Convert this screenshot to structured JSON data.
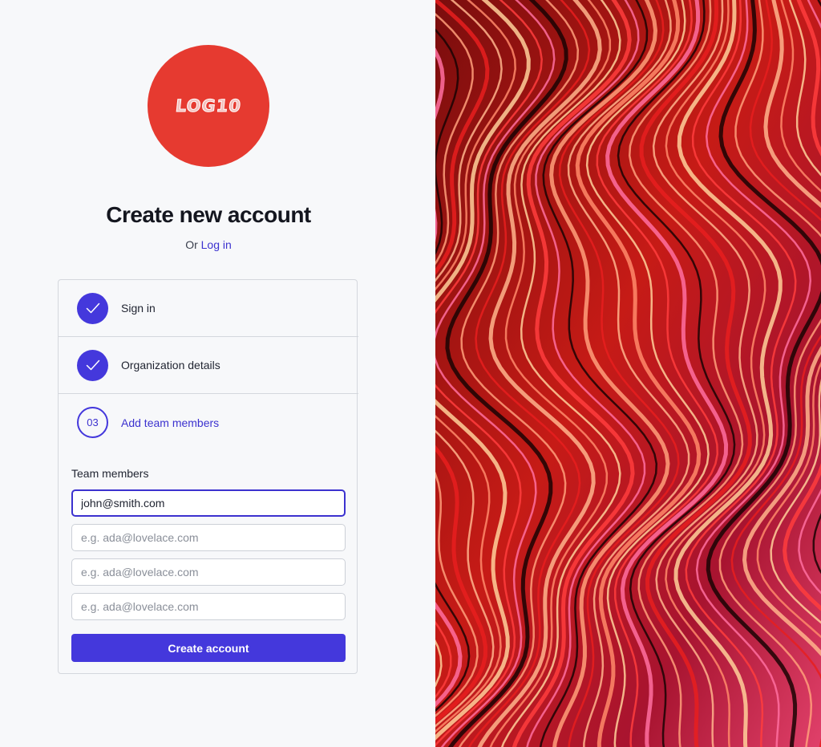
{
  "logo": {
    "text": "LOG10"
  },
  "header": {
    "title": "Create new account",
    "or_text": "Or",
    "login_link": "Log in"
  },
  "steps": [
    {
      "status": "complete",
      "icon": "check-icon",
      "label": "Sign in"
    },
    {
      "status": "complete",
      "icon": "check-icon",
      "label": "Organization details"
    },
    {
      "status": "current",
      "number": "03",
      "label": "Add team members"
    }
  ],
  "form": {
    "label": "Team members",
    "inputs": [
      {
        "value": "john@smith.com",
        "placeholder": "e.g. ada@lovelace.com"
      },
      {
        "value": "",
        "placeholder": "e.g. ada@lovelace.com"
      },
      {
        "value": "",
        "placeholder": "e.g. ada@lovelace.com"
      },
      {
        "value": "",
        "placeholder": "e.g. ada@lovelace.com"
      }
    ],
    "submit_label": "Create account"
  },
  "colors": {
    "accent": "#4438dc",
    "logo_bg": "#e63a30",
    "page_bg": "#f7f8fa"
  },
  "hero": {
    "icon": "abstract-wave-artwork"
  }
}
